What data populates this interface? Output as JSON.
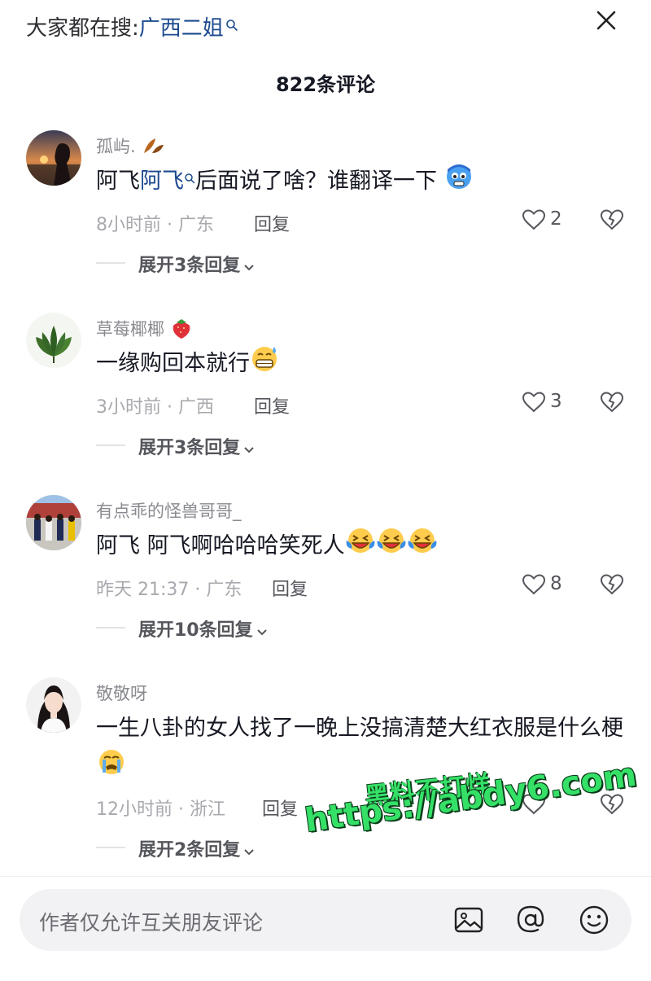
{
  "header": {
    "search_prefix": "大家都在搜:",
    "search_keyword": "广西二姐",
    "title": "822条评论"
  },
  "comments": [
    {
      "username": "孤屿.",
      "text_a": "阿飞",
      "text_link": "阿飞",
      "text_b": "后面说了啥？谁翻译一下",
      "time_location": "8小时前 · 广东",
      "reply_label": "回复",
      "likes": "2",
      "expand_label": "展开3条回复"
    },
    {
      "username": "草莓椰椰",
      "text": "一缘购回本就行",
      "time_location": "3小时前 · 广西",
      "reply_label": "回复",
      "likes": "3",
      "expand_label": "展开3条回复"
    },
    {
      "username": "有点乖的怪兽哥哥_",
      "text": "阿飞 阿飞啊哈哈哈笑死人",
      "time_location": "昨天 21:37 · 广东",
      "reply_label": "回复",
      "likes": "8",
      "expand_label": "展开10条回复"
    },
    {
      "username": "敬敬呀",
      "text": "一生八卦的女人找了一晚上没搞清楚大红衣服是什么梗",
      "time_location": "12小时前 · 浙江",
      "reply_label": "回复",
      "expand_label": "展开2条回复"
    }
  ],
  "watermark": {
    "line1": "黑料不打烊",
    "line2": "https://abdy6.com"
  },
  "input_bar": {
    "placeholder": "作者仅允许互关朋友评论"
  },
  "icons": [
    "search-icon",
    "close-icon",
    "heart-icon",
    "dislike-heart-icon",
    "chevron-down-icon",
    "image-icon",
    "at-icon",
    "emoji-icon"
  ],
  "colors": {
    "link": "#1b4a8f",
    "meta": "#a8a9ae",
    "watermark": "#35e067"
  }
}
